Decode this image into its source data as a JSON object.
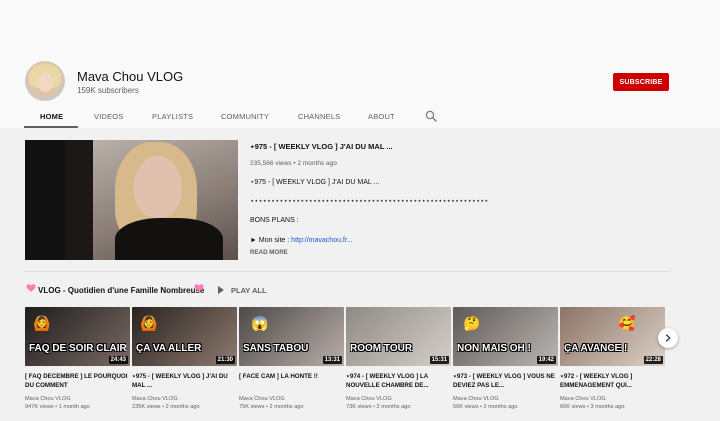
{
  "channel": {
    "name": "Mava Chou VLOG",
    "subscribers": "159K subscribers",
    "subscribe_label": "SUBSCRIBE"
  },
  "tabs": [
    {
      "label": "HOME",
      "active": true
    },
    {
      "label": "VIDEOS"
    },
    {
      "label": "PLAYLISTS"
    },
    {
      "label": "COMMUNITY"
    },
    {
      "label": "CHANNELS"
    },
    {
      "label": "ABOUT"
    }
  ],
  "featured": {
    "title": "⋆975 - [ WEEKLY VLOG ] J'AI DU MAL ...",
    "meta": "235,566 views • 2 months ago",
    "description_line1": "⋆975 - [ WEEKLY VLOG ] J'AI DU MAL ...",
    "stars_line": "⋆⋆⋆⋆⋆⋆⋆⋆⋆⋆⋆⋆⋆⋆⋆⋆⋆⋆⋆⋆⋆⋆⋆⋆⋆⋆⋆⋆⋆⋆⋆⋆⋆⋆⋆⋆⋆⋆⋆⋆⋆⋆⋆⋆⋆⋆⋆⋆⋆⋆⋆⋆⋆⋆⋆⋆⋆",
    "plans": "BONS PLANS :",
    "site_prefix": "► Mon site : ",
    "site_link": "http://mavachou.fr...",
    "read_more": "READ MORE"
  },
  "playlist": {
    "title": "VLOG - Quotidien d'une Famille Nombreuse",
    "play_all": "PLAY ALL"
  },
  "videos": [
    {
      "overlay": "FAQ DE SOIR CLAIR",
      "duration": "24:43",
      "title": "[ FAQ DECEMBRE ] LE POURQUOI DU COMMENT",
      "channel": "Mava Chou VLOG",
      "meta": "947K views • 1 month ago",
      "colors": [
        "#1d1d1d",
        "#7b6a64"
      ]
    },
    {
      "overlay": "ÇA VA ALLER",
      "duration": "21:30",
      "title": "⋆975 - [ WEEKLY VLOG ] J'AI DU MAL ...",
      "channel": "Mava Chou VLOG",
      "meta": "235K views • 2 months ago",
      "colors": [
        "#2a2320",
        "#8e7b70"
      ]
    },
    {
      "overlay": "SANS TABOU",
      "duration": "13:31",
      "title": "[ FACE CAM ] LA HONTE !!",
      "channel": "Mava Chou VLOG",
      "meta": "75K views • 2 months ago",
      "colors": [
        "#4d4a48",
        "#b9aea9"
      ]
    },
    {
      "overlay": "ROOM TOUR",
      "duration": "15:31",
      "title": "⋆974 - [ WEEKLY VLOG ] LA NOUVELLE CHAMBRE DE...",
      "channel": "Mava Chou VLOG",
      "meta": "73K views • 2 months ago",
      "colors": [
        "#8f8a84",
        "#d4cfc8"
      ]
    },
    {
      "overlay": "NON MAIS OH !",
      "duration": "19:42",
      "title": "⋆973 - [ WEEKLY VLOG ] VOUS NE DEVIEZ PAS LE...",
      "channel": "Mava Chou VLOG",
      "meta": "56K views • 2 months ago",
      "colors": [
        "#5e5a57",
        "#bdb7b3"
      ]
    },
    {
      "overlay": "ÇA AVANCE !",
      "duration": "22:28",
      "title": "⋆972 - [ WEEKLY VLOG ] EMMENAGEMENT QUI...",
      "channel": "Mava Chou VLOG",
      "meta": "66K views • 3 months ago",
      "colors": [
        "#8c7466",
        "#ddd1c7"
      ]
    }
  ]
}
